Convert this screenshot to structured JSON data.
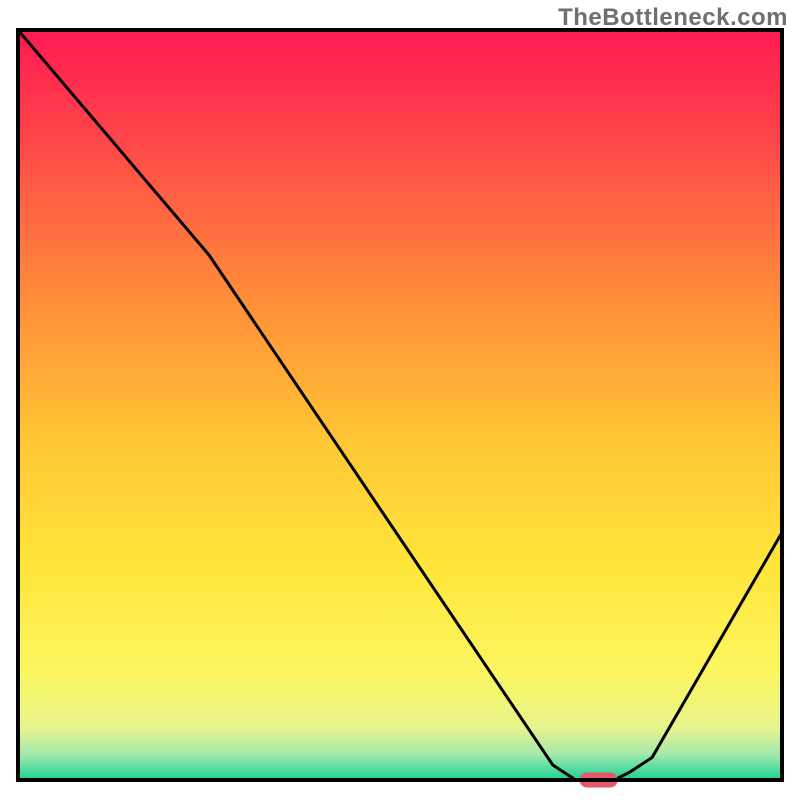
{
  "watermark": "TheBottleneck.com",
  "chart_data": {
    "type": "line",
    "title": "",
    "xlabel": "",
    "ylabel": "",
    "xlim": [
      0,
      100
    ],
    "ylim": [
      0,
      100
    ],
    "series": [
      {
        "name": "curve",
        "x": [
          0,
          25,
          70,
          73,
          78,
          80,
          83,
          100
        ],
        "y": [
          100,
          70,
          2,
          0,
          0,
          1,
          3,
          33
        ]
      }
    ],
    "marker": {
      "name": "optimal-point",
      "x": 76,
      "y": 0,
      "color": "#e15a6a",
      "width": 5,
      "height": 2
    },
    "background_gradient": {
      "stops": [
        {
          "offset": 0.0,
          "color": "#ff1a52"
        },
        {
          "offset": 0.12,
          "color": "#ff3e4b"
        },
        {
          "offset": 0.35,
          "color": "#ff8a3a"
        },
        {
          "offset": 0.55,
          "color": "#ffc734"
        },
        {
          "offset": 0.72,
          "color": "#ffe63a"
        },
        {
          "offset": 0.86,
          "color": "#fbf662"
        },
        {
          "offset": 0.93,
          "color": "#e7f48c"
        },
        {
          "offset": 0.965,
          "color": "#a6e9ab"
        },
        {
          "offset": 0.985,
          "color": "#55dca0"
        },
        {
          "offset": 1.0,
          "color": "#1fd08e"
        }
      ]
    },
    "border_color": "#000000",
    "border_width": 4
  }
}
